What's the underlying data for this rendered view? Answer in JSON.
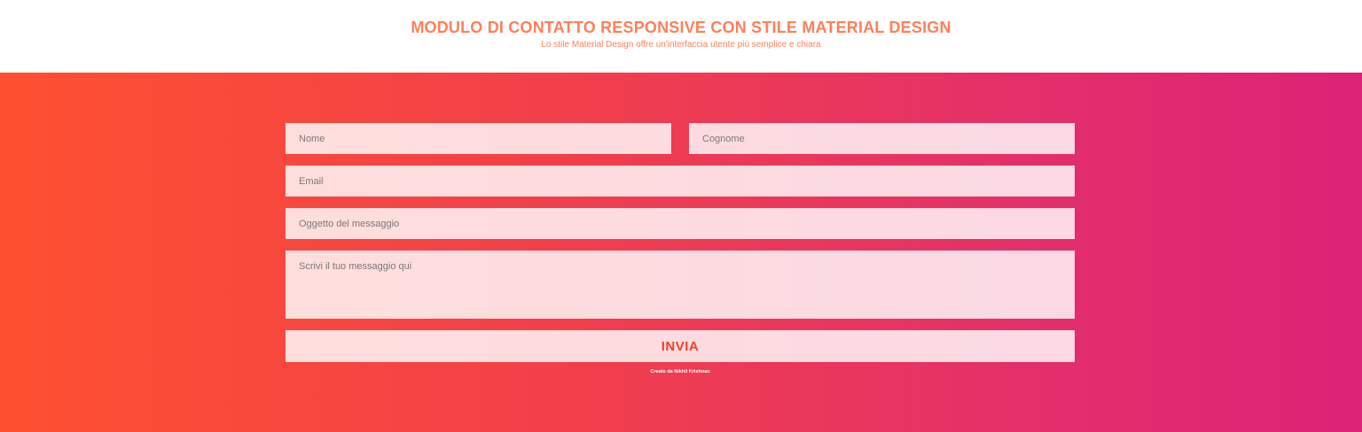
{
  "header": {
    "title": "MODULO DI CONTATTO RESPONSIVE CON STILE MATERIAL DESIGN",
    "subtitle": "Lo stile Material Design offre un'interfaccia utente più semplice e chiara"
  },
  "form": {
    "first_name": {
      "placeholder": "Nome",
      "value": ""
    },
    "last_name": {
      "placeholder": "Cognome",
      "value": ""
    },
    "email": {
      "placeholder": "Email",
      "value": ""
    },
    "subject": {
      "placeholder": "Oggetto del messaggio",
      "value": ""
    },
    "message": {
      "placeholder": "Scrivi il tuo messaggio qui",
      "value": ""
    },
    "submit_label": "INVIA"
  },
  "footer": {
    "credit": "Creato da Nikhil Krishnan"
  },
  "colors": {
    "accent": "#fd8057",
    "gradient_start": "#fe5030",
    "gradient_end": "#dc2277",
    "button_text": "#f0412b"
  }
}
